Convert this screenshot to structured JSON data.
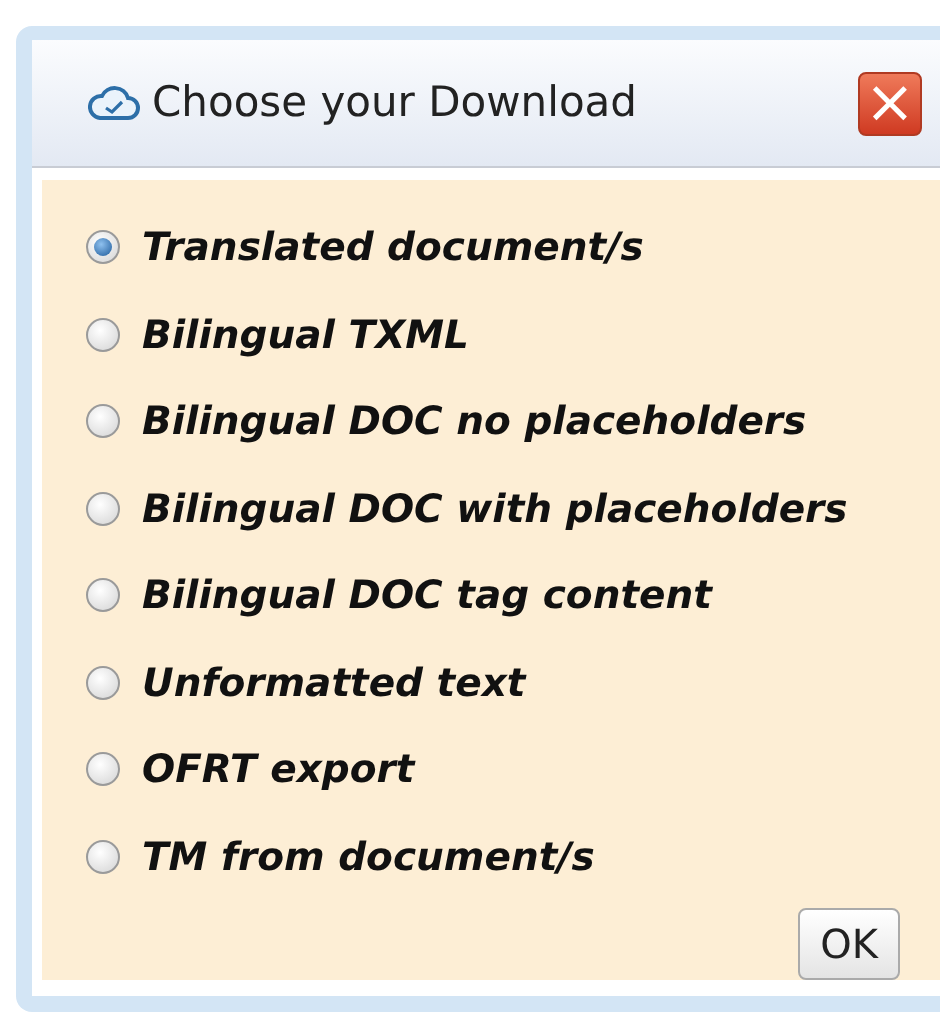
{
  "dialog": {
    "title": "Choose your Download",
    "close": "×",
    "options": [
      {
        "label": "Translated document/s",
        "selected": true
      },
      {
        "label": "Bilingual TXML",
        "selected": false
      },
      {
        "label": "Bilingual DOC no placeholders",
        "selected": false
      },
      {
        "label": "Bilingual DOC with placeholders",
        "selected": false
      },
      {
        "label": "Bilingual DOC tag content",
        "selected": false
      },
      {
        "label": "Unformatted text",
        "selected": false
      },
      {
        "label": "OFRT export",
        "selected": false
      },
      {
        "label": "TM from document/s",
        "selected": false
      }
    ],
    "buttons": [
      "OK"
    ]
  }
}
